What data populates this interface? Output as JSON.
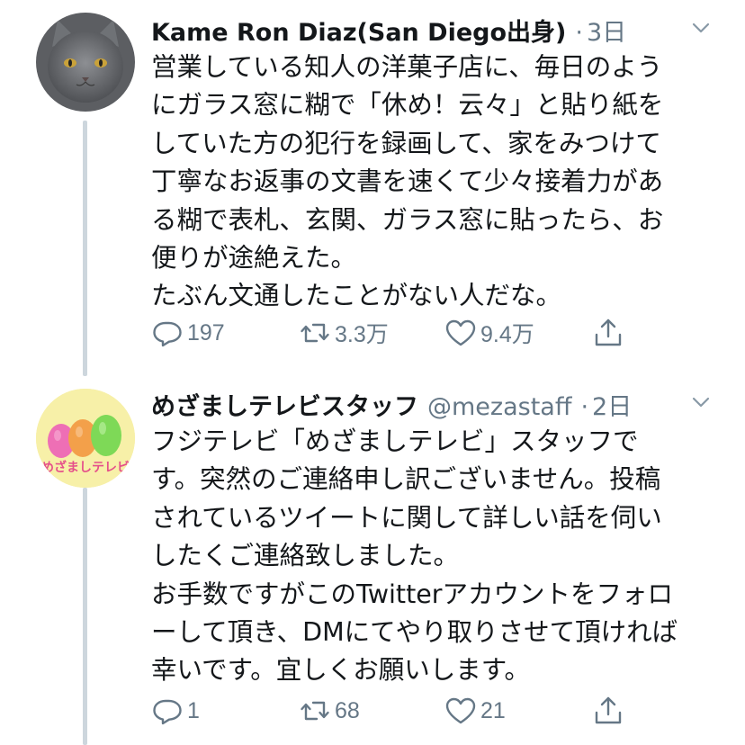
{
  "tweets": [
    {
      "name": "Kame Ron Diaz(San Diego出身)",
      "handle": "",
      "dot": "·",
      "time": "3日",
      "lines": [
        "営業している知人の洋菓子店に、毎日のよう",
        "にガラス窓に糊で「休め！云々」と貼り紙を",
        "していた方の犯行を録画して、家をみつけて",
        "丁寧なお返事の文書を速くて少々接着力があ",
        "る糊で表札、玄関、ガラス窓に貼ったら、お",
        "便りが途絶えた。",
        "たぶん文通したことがない人だな。"
      ],
      "replies": "197",
      "retweets": "3.3万",
      "likes": "9.4万",
      "avatar_icon": "cat-avatar"
    },
    {
      "name": "めざましテレビスタッフ",
      "handle": "@mezastaff",
      "dot": "·",
      "time": "2日",
      "lines": [
        "フジテレビ「めざましテレビ」スタッフで",
        "す。突然のご連絡申し訳ございません。投稿",
        "されているツイートに関して詳しい話を伺い",
        "したくご連絡致しました。",
        "お手数ですがこのTwitterアカウントをフォロ",
        "ーして頂き、DMにてやり取りさせて頂ければ",
        "幸いです。宜しくお願いします。"
      ],
      "replies": "1",
      "retweets": "68",
      "likes": "21",
      "avatar_icon": "mezamashi-logo-avatar",
      "logo_text": "めざましテレビ"
    }
  ],
  "colors": {
    "text": "#14171a",
    "secondary": "#657786",
    "thread_line": "#cdd6dd"
  }
}
